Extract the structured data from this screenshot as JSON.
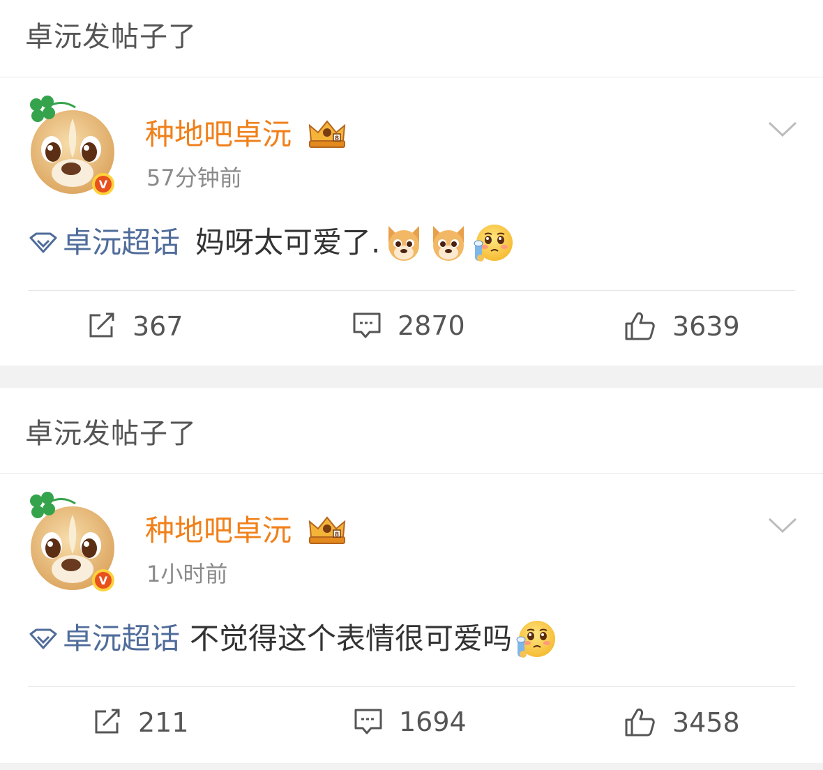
{
  "posts": [
    {
      "header": "卓沅发帖子了",
      "author": {
        "name": "种地吧卓沅",
        "avatar_icon": "puppy-avatar-icon",
        "verified_badge": "V",
        "crown_icon": "vip-crown-icon"
      },
      "time": "57分钟前",
      "topic": "卓沅超话",
      "text": "妈呀太可爱了.",
      "emojis": [
        "dog-emoji-icon",
        "dog-emoji-icon",
        "crying-emoji-icon"
      ],
      "stats": {
        "reposts": "367",
        "comments": "2870",
        "likes": "3639"
      }
    },
    {
      "header": "卓沅发帖子了",
      "author": {
        "name": "种地吧卓沅",
        "avatar_icon": "puppy-avatar-icon",
        "verified_badge": "V",
        "crown_icon": "vip-crown-icon"
      },
      "time": "1小时前",
      "topic": "卓沅超话",
      "text": "不觉得这个表情很可爱吗",
      "emojis": [
        "crying-emoji-icon"
      ],
      "stats": {
        "reposts": "211",
        "comments": "1694",
        "likes": "3458"
      }
    }
  ],
  "colors": {
    "username": "#f0801a",
    "topic": "#4f6c9a",
    "verified": "#e8501c",
    "page_bg": "#f2f2f2"
  }
}
